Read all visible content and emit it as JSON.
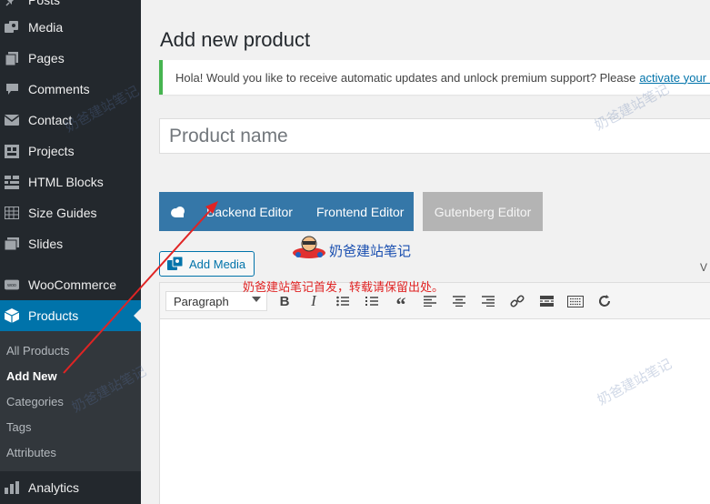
{
  "sidebar": {
    "items": [
      {
        "label": "Posts",
        "icon": "pin-icon"
      },
      {
        "label": "Media",
        "icon": "media-icon"
      },
      {
        "label": "Pages",
        "icon": "pages-icon"
      },
      {
        "label": "Comments",
        "icon": "comment-icon"
      },
      {
        "label": "Contact",
        "icon": "mail-icon"
      },
      {
        "label": "Projects",
        "icon": "portfolio-icon"
      },
      {
        "label": "HTML Blocks",
        "icon": "grid-icon"
      },
      {
        "label": "Size Guides",
        "icon": "table-icon"
      },
      {
        "label": "Slides",
        "icon": "slides-icon"
      },
      {
        "label": "WooCommerce",
        "icon": "woo-icon"
      },
      {
        "label": "Products",
        "icon": "box-icon"
      },
      {
        "label": "Analytics",
        "icon": "chart-bar-icon"
      }
    ],
    "submenu": [
      "All Products",
      "Add New",
      "Categories",
      "Tags",
      "Attributes"
    ]
  },
  "page": {
    "title": "Add new product",
    "notice_text": "Hola! Would you like to receive automatic updates and unlock premium support? Please",
    "notice_link": "activate your c",
    "product_name_placeholder": "Product name"
  },
  "editors": {
    "backend": "Backend Editor",
    "frontend": "Frontend Editor",
    "gutenberg": "Gutenberg Editor"
  },
  "media": {
    "add_media": "Add Media"
  },
  "toolbar": {
    "format": "Paragraph",
    "tab_peek": "V"
  },
  "overlay": {
    "credit": "奶爸建站笔记",
    "repost": "奶爸建站笔记首发，转载请保留出处。",
    "watermark": "奶爸建站笔记"
  },
  "colors": {
    "sidebar": "#23282d",
    "submenu": "#32373c",
    "active": "#0073aa",
    "editor_buttons": "#3577a8",
    "notice_border": "#46b450",
    "annotation_arrow": "#e02424"
  }
}
